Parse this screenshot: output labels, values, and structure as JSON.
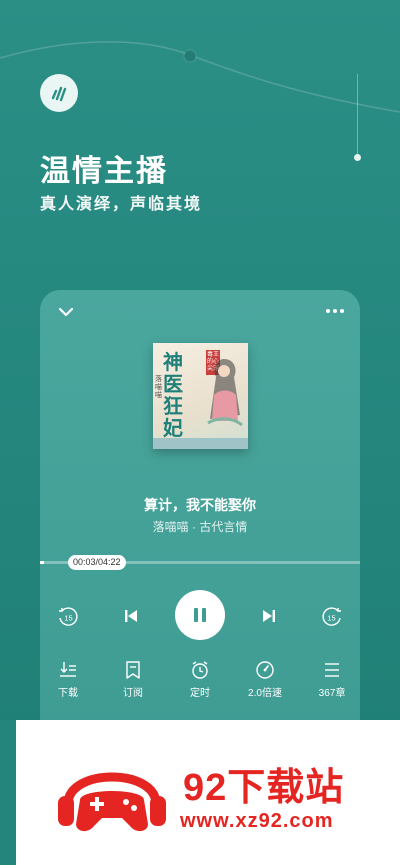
{
  "hero": {
    "headline": "温情主播",
    "subline": "真人演绎，声临其境"
  },
  "player": {
    "cover": {
      "title_chars": "神医狂妃",
      "author": "落喵喵",
      "tag": "毒王的心尖宠"
    },
    "track_title": "算计，我不能娶你",
    "track_meta": "落喵喵 · 古代言情",
    "time_display": "00:03/04:22",
    "progress": 0.012,
    "skip_back_seconds": "15",
    "skip_forward_seconds": "15",
    "bottom_bar": [
      {
        "label": "下载",
        "icon": "download-icon"
      },
      {
        "label": "订阅",
        "icon": "bookmark-icon"
      },
      {
        "label": "定时",
        "icon": "alarm-clock-icon"
      },
      {
        "label": "2.0倍速",
        "icon": "speed-icon"
      },
      {
        "label": "367章",
        "icon": "chapter-list-icon"
      }
    ]
  },
  "watermark": {
    "name": "92下载站",
    "url": "www.xz92.com"
  },
  "colors": {
    "background": "#23857c",
    "card": "#45a299",
    "accent_red": "#e52521"
  }
}
